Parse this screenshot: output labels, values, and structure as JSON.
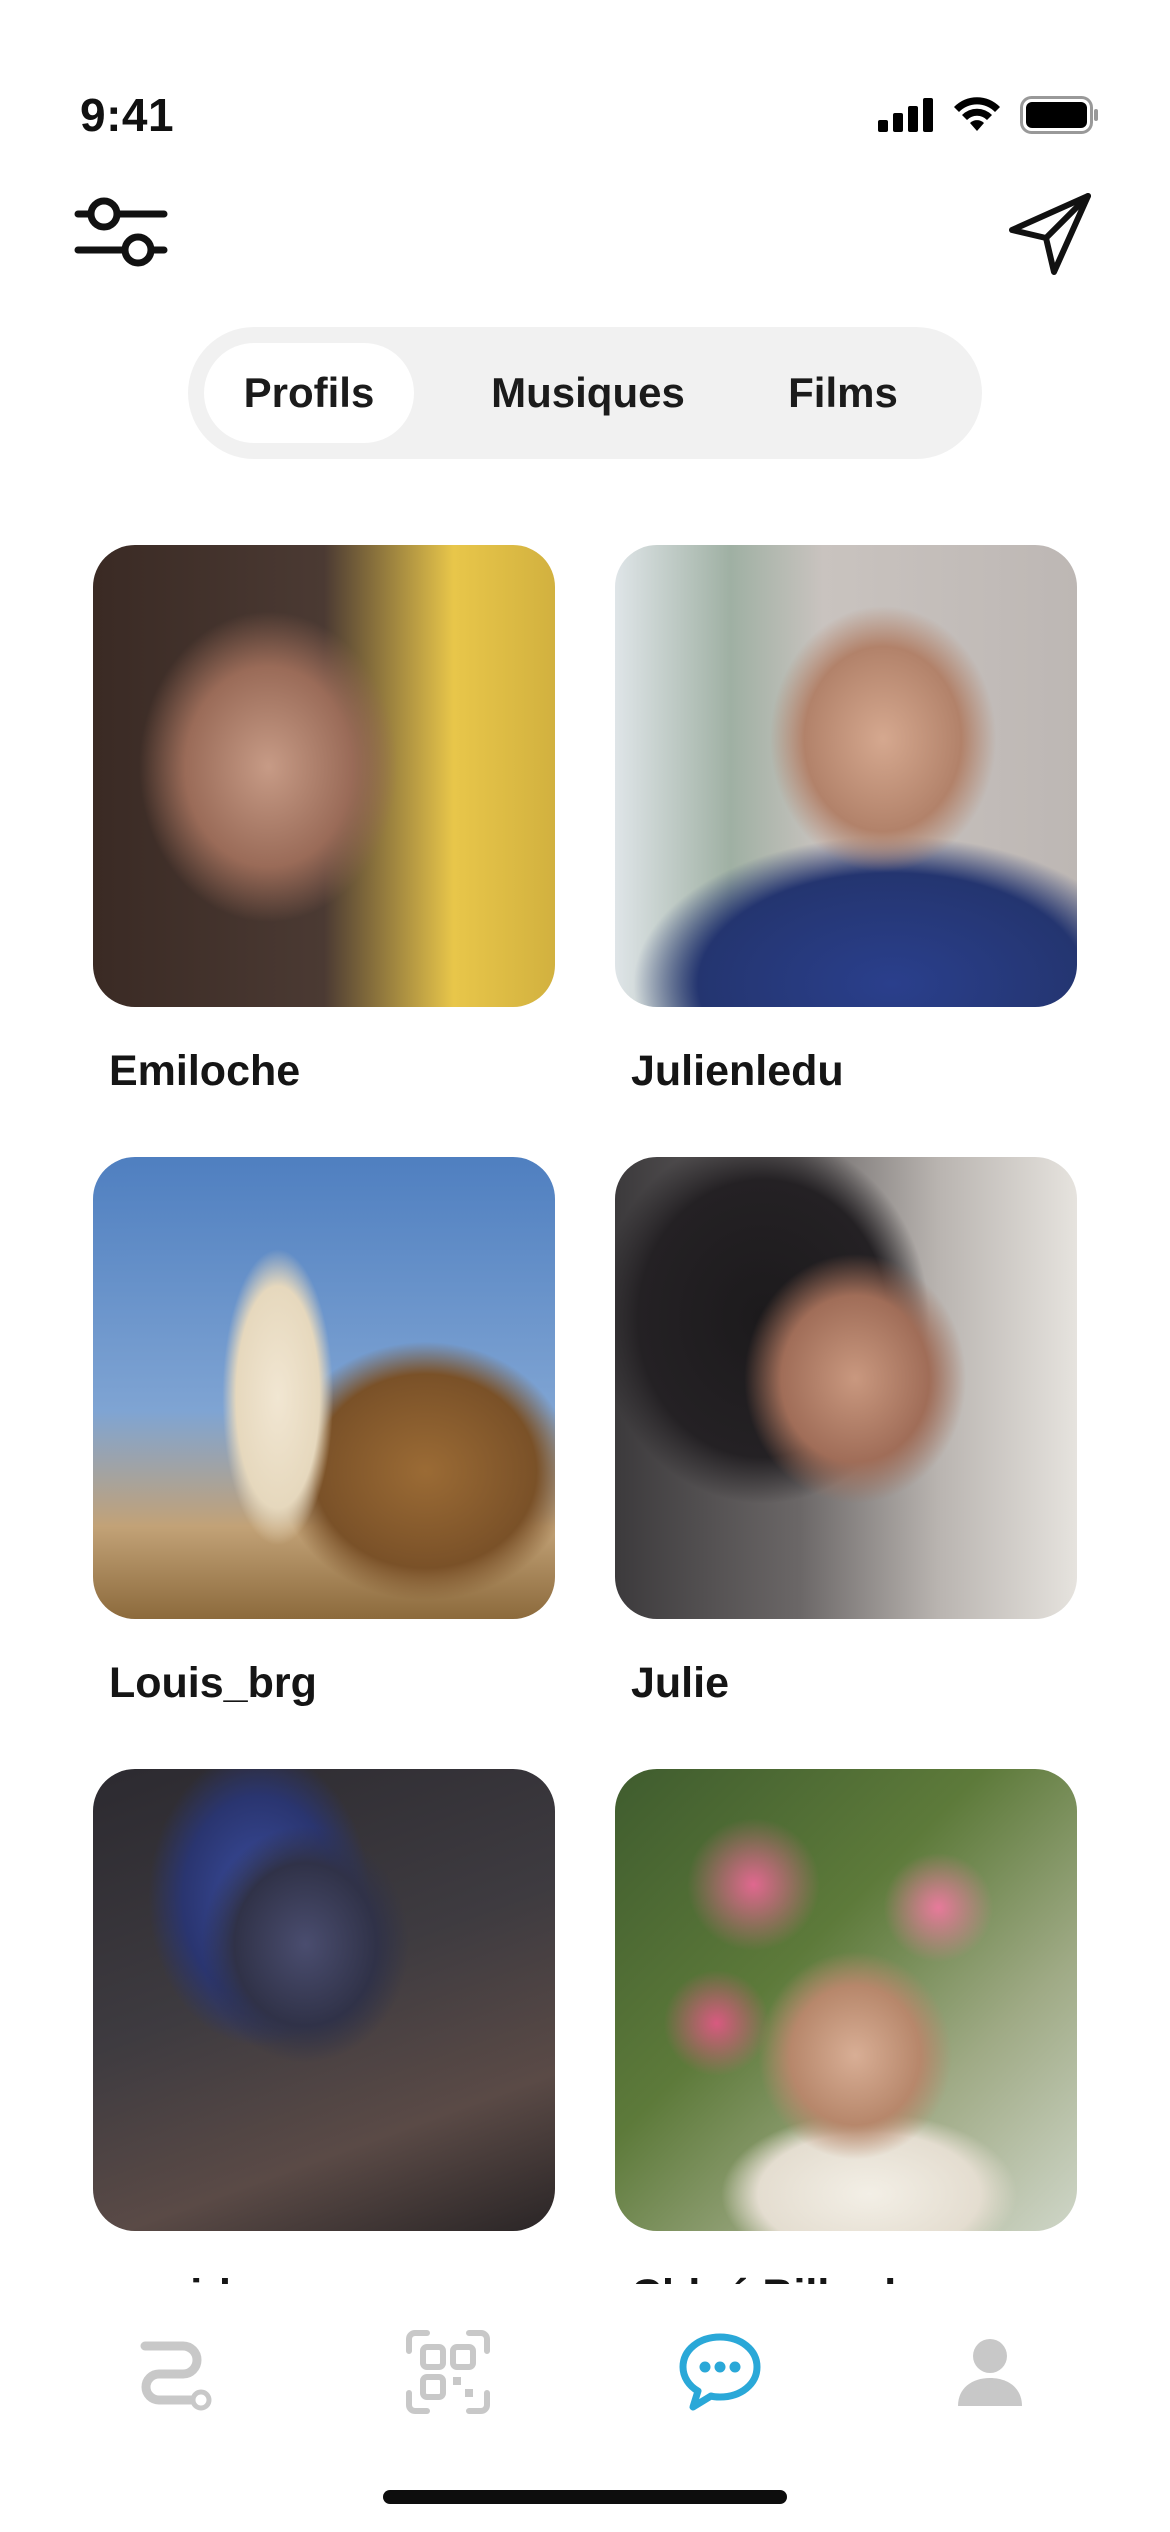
{
  "status_bar": {
    "time": "9:41",
    "icons": [
      "signal-icon",
      "wifi-icon",
      "battery-icon"
    ]
  },
  "top_bar": {
    "left_icon": "filter-sliders-icon",
    "right_icon": "send-paper-plane-icon"
  },
  "tabs": [
    {
      "label": "Profils",
      "active": true
    },
    {
      "label": "Musiques",
      "active": false
    },
    {
      "label": "Films",
      "active": false
    }
  ],
  "profiles": [
    {
      "name": "Emiloche"
    },
    {
      "name": "Julienledu"
    },
    {
      "name": "Louis_brg"
    },
    {
      "name": "Julie"
    },
    {
      "name": "x_wirko_x"
    },
    {
      "name": "Chloé Billard"
    }
  ],
  "bottom_nav": [
    {
      "icon": "route-icon",
      "active": false
    },
    {
      "icon": "qr-code-icon",
      "active": false
    },
    {
      "icon": "chat-bubble-icon",
      "active": true
    },
    {
      "icon": "user-icon",
      "active": false
    }
  ],
  "colors": {
    "accent": "#2aa8d8",
    "inactive_icon": "#c8c8c8",
    "tab_track": "#f1f1f1"
  }
}
